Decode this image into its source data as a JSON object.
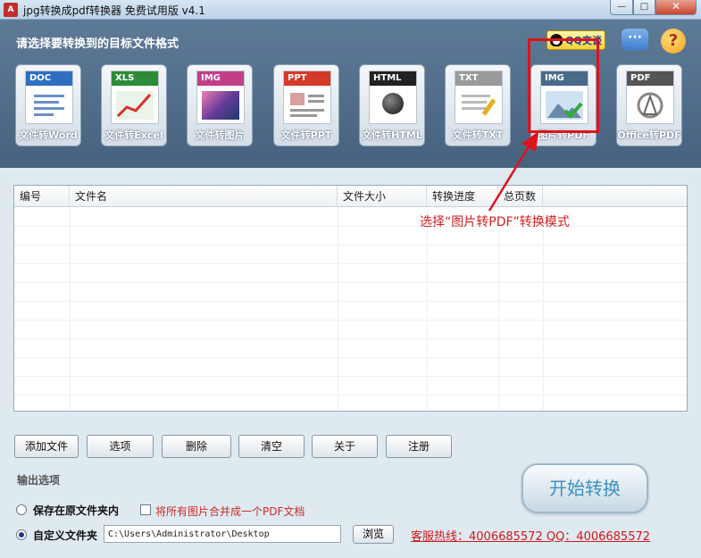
{
  "window": {
    "title": "jpg转换成pdf转换器 免费试用版 v4.1",
    "app_icon": "A",
    "min": "—",
    "max": "□",
    "close": "✕"
  },
  "header": {
    "title": "请选择要转换到的目标文件格式",
    "qq_button": "QQ交谈",
    "chat_icon": "···",
    "help_icon": "?"
  },
  "formats": [
    {
      "tag": "DOC",
      "label": "文件转Word",
      "color": "#2f6fc1"
    },
    {
      "tag": "XLS",
      "label": "文件转Excel",
      "color": "#2e8b3a"
    },
    {
      "tag": "IMG",
      "label": "文件转图片",
      "color": "#c23f88"
    },
    {
      "tag": "PPT",
      "label": "文件转PPT",
      "color": "#d43a2a"
    },
    {
      "tag": "HTML",
      "label": "文件转HTML",
      "color": "#222222"
    },
    {
      "tag": "TXT",
      "label": "文件转TXT",
      "color": "#9a9a9a"
    },
    {
      "tag": "IMG",
      "label": "图片转PDF",
      "color": "#4a6a8a",
      "selected": true
    },
    {
      "tag": "PDF",
      "label": "Office转PDF",
      "color": "#555555"
    }
  ],
  "table": {
    "columns": [
      "编号",
      "文件名",
      "文件大小",
      "转换进度",
      "总页数"
    ],
    "rows": []
  },
  "callout": "选择“图片转PDF”转换模式",
  "actions": [
    "添加文件",
    "选项",
    "删除",
    "清空",
    "关于",
    "注册"
  ],
  "output": {
    "section_title": "输出选项",
    "keep_original_label": "保存在原文件夹内",
    "merge_label": "将所有图片合并成一个PDF文档",
    "custom_folder_label": "自定义文件夹",
    "path_value": "C:\\Users\\Administrator\\Desktop",
    "browse_label": "浏览"
  },
  "hotline": "客服热线：4006685572 QQ：4006685572",
  "start_button": "开始转换"
}
